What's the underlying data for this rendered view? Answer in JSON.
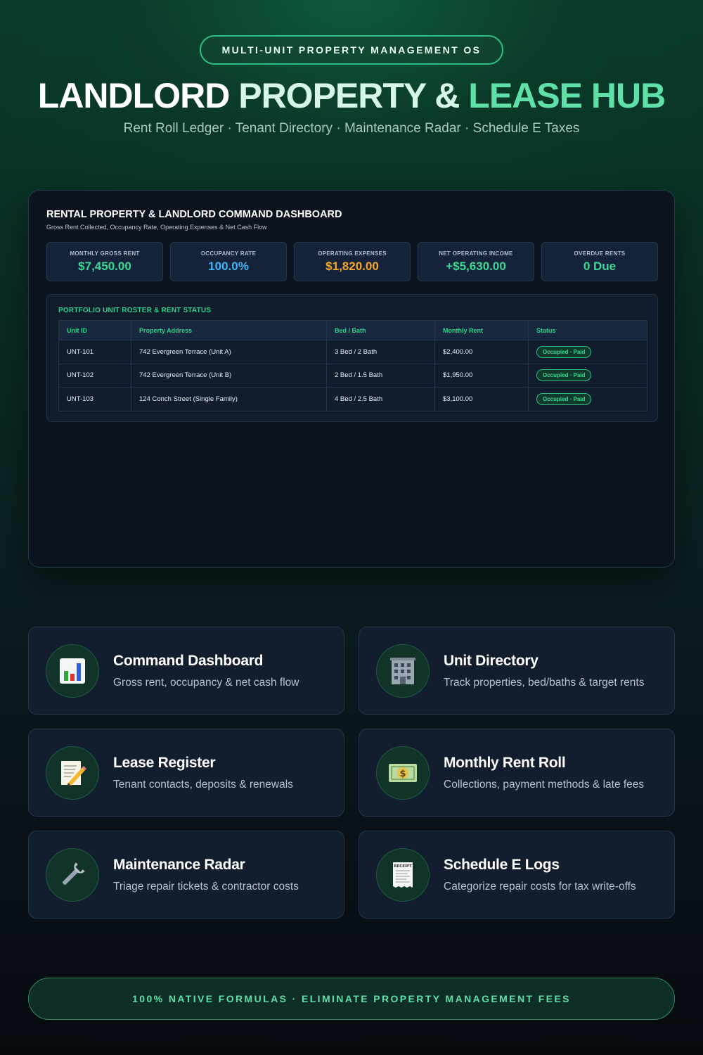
{
  "hero": {
    "badge": "MULTI-UNIT PROPERTY MANAGEMENT OS",
    "title_part1": "LANDLORD",
    "title_part2": "PROPERTY &",
    "title_part3": "LEASE HUB",
    "subtitle": "Rent Roll Ledger · Tenant Directory · Maintenance Radar · Schedule E Taxes"
  },
  "dashboard": {
    "title": "RENTAL PROPERTY & LANDLORD COMMAND DASHBOARD",
    "subtitle": "Gross Rent Collected, Occupancy Rate, Operating Expenses & Net Cash Flow",
    "kpis": [
      {
        "label": "MONTHLY GROSS RENT",
        "value": "$7,450.00",
        "color": "#3ad893"
      },
      {
        "label": "OCCUPANCY RATE",
        "value": "100.0%",
        "color": "#3fb4f5"
      },
      {
        "label": "OPERATING EXPENSES",
        "value": "$1,820.00",
        "color": "#f5a623"
      },
      {
        "label": "NET OPERATING INCOME",
        "value": "+$5,630.00",
        "color": "#3ad893"
      },
      {
        "label": "OVERDUE RENTS",
        "value": "0 Due",
        "color": "#3ad893"
      }
    ],
    "roster": {
      "title": "PORTFOLIO UNIT ROSTER & RENT STATUS",
      "columns": [
        "Unit ID",
        "Property Address",
        "Bed / Bath",
        "Monthly Rent",
        "Status"
      ],
      "rows": [
        [
          "UNT-101",
          "742 Evergreen Terrace (Unit A)",
          "3 Bed / 2 Bath",
          "$2,400.00",
          "Occupied · Paid"
        ],
        [
          "UNT-102",
          "742 Evergreen Terrace (Unit B)",
          "2 Bed / 1.5 Bath",
          "$1,950.00",
          "Occupied · Paid"
        ],
        [
          "UNT-103",
          "124 Conch Street (Single Family)",
          "4 Bed / 2.5 Bath",
          "$3,100.00",
          "Occupied · Paid"
        ]
      ]
    }
  },
  "features": [
    {
      "icon": "bar-chart-icon",
      "title": "Command Dashboard",
      "desc": "Gross rent, occupancy & net cash flow"
    },
    {
      "icon": "office-building-icon",
      "title": "Unit Directory",
      "desc": "Track properties, bed/baths & target rents"
    },
    {
      "icon": "memo-pencil-icon",
      "title": "Lease Register",
      "desc": "Tenant contacts, deposits & renewals"
    },
    {
      "icon": "money-bill-icon",
      "title": "Monthly Rent Roll",
      "desc": "Collections, payment methods & late fees"
    },
    {
      "icon": "wrench-icon",
      "title": "Maintenance Radar",
      "desc": "Triage repair tickets & contractor costs"
    },
    {
      "icon": "receipt-icon",
      "title": "Schedule E Logs",
      "desc": "Categorize repair costs for tax write-offs"
    }
  ],
  "icon_texts": {
    "money_symbol": "$",
    "receipt_header": "RECEIPT"
  },
  "footer": "100% NATIVE FORMULAS · ELIMINATE PROPERTY MANAGEMENT FEES"
}
